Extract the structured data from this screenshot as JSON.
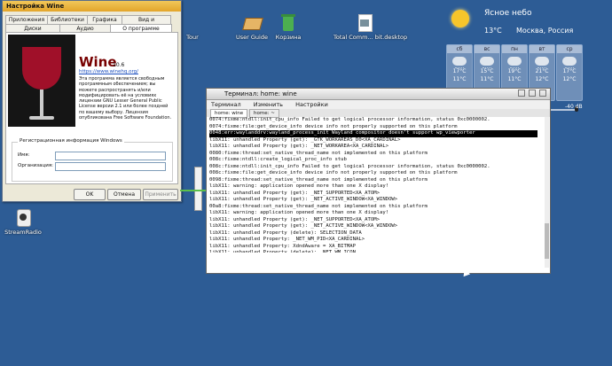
{
  "desktop_icons": [
    {
      "label": "Tour"
    },
    {
      "label": "User Guide"
    },
    {
      "label": "Корзина"
    },
    {
      "label": "Total Comm... bit.desktop"
    },
    {
      "label": "StreamRadio"
    }
  ],
  "weather": {
    "condition": "Ясное небо",
    "temp": "13°C",
    "location": "Москва, Россия",
    "days": [
      {
        "day": "сб",
        "hi": "17°C",
        "lo": "11°C"
      },
      {
        "day": "вс",
        "hi": "15°C",
        "lo": "11°C"
      },
      {
        "day": "пн",
        "hi": "19°C",
        "lo": "11°C"
      },
      {
        "day": "вт",
        "hi": "21°C",
        "lo": "12°C"
      },
      {
        "day": "ср",
        "hi": "17°C",
        "lo": "12°C"
      }
    ],
    "volume_label": "-40 dB"
  },
  "wine": {
    "title": "Настройка Wine",
    "tabs_top": [
      "Приложения",
      "Библиотеки",
      "Графика",
      "Вид и интеграция"
    ],
    "tabs_bottom": [
      "Диски",
      "Аудио",
      "О программе"
    ],
    "app_name": "Wine",
    "version": "10.6",
    "url": "https://www.winehq.org/",
    "description": "Эта программа является свободным программным обеспечением; вы можете распространять и/или модифицировать её на условиях лицензии GNU Lesser General Public License версии 2.1 или более поздней по вашему выбору. Лицензия опубликована Free Software Foundation.",
    "reg_legend": "Регистрационная информация Windows",
    "name_label": "Имя:",
    "org_label": "Организация:",
    "ok": "OK",
    "cancel": "Отмена",
    "apply": "Применить"
  },
  "terminal": {
    "title": "Терминал: home: wine",
    "menu": [
      "Терминал",
      "Изменить",
      "Настройки"
    ],
    "tabs": [
      "home: wine",
      "home: ~"
    ],
    "lines": [
      "0074:fixme:ntdll:init_cpu_info Failed to get logical processor information, status 0xc0000002.",
      "0074:fixme:file:get_device_info device info not properly supported on this platform",
      "0048:err:waylanddrv:wayland_process_init Wayland compositor doesn't support wp_viewporter",
      "libX11: unhandled Property (get): _GTK_WORKAREAS_D0<XA_CARDINAL>",
      "libX11: unhandled Property (get): _NET_WORKAREA<XA_CARDINAL>",
      "0080:fixme:thread:set_native_thread_name not implemented on this platform",
      "008c:fixme:ntdll:create_logical_proc_info stub",
      "008c:fixme:ntdll:init_cpu_info Failed to get logical processor information, status 0xc0000002.",
      "008c:fixme:file:get_device_info device info not properly supported on this platform",
      "0098:fixme:thread:set_native_thread_name not implemented on this platform",
      "libX11: warning: application opened more than one X display!",
      "libX11: unhandled Property (get): _NET_SUPPORTED<XA_ATOM>",
      "libX11: unhandled Property (get): _NET_ACTIVE_WINDOW<XA_WINDOW>",
      "00a8:fixme:thread:set_native_thread_name not implemented on this platform",
      "libX11: warning: application opened more than one X display!",
      "libX11: unhandled Property (get): _NET_SUPPORTED<XA_ATOM>",
      "libX11: unhandled Property (get): _NET_ACTIVE_WINDOW<XA_WINDOW>",
      "libX11: unhandled Property (delete): SELECTION_DATA",
      "libX11: unhandled Property: _NET_WM_PID<XA_CARDINAL>",
      "libX11: unhandled Property: XdndAware = XA_BITMAP",
      "libX11: unhandled Property (delete): _NET_WM_ICON"
    ],
    "highlight_index": 2
  }
}
